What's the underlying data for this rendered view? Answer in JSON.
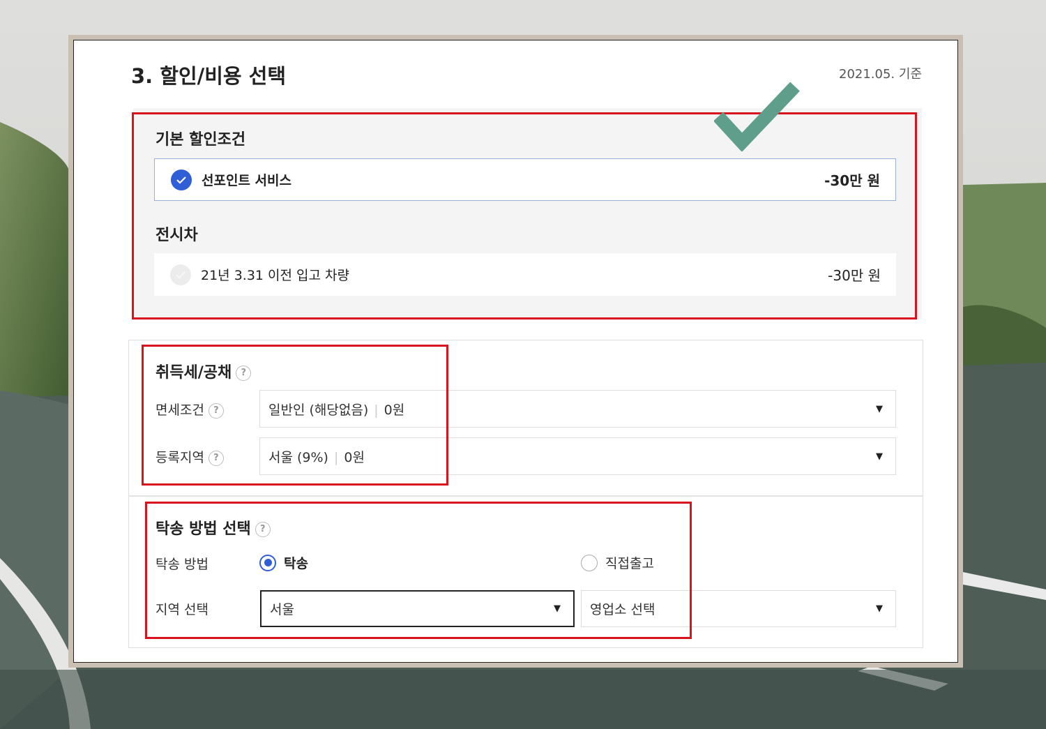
{
  "header": {
    "title": "3. 할인/비용 선택",
    "date": "2021.05. 기준"
  },
  "discount": {
    "basic_heading": "기본 할인조건",
    "basic_option": {
      "label": "선포인트 서비스",
      "price": "-30만 원",
      "checked": true
    },
    "display_heading": "전시차",
    "display_option": {
      "label": "21년 3.31 이전 입고 차량",
      "price": "-30만 원",
      "checked": false
    }
  },
  "tax": {
    "heading": "취득세/공채",
    "help": "?",
    "exemption": {
      "label": "면세조건",
      "value": "일반인 (해당없음)",
      "amount": "0원"
    },
    "region": {
      "label": "등록지역",
      "value": "서울 (9%)",
      "amount": "0원"
    }
  },
  "delivery": {
    "heading": "탁송 방법 선택",
    "help": "?",
    "method_label": "탁송 방법",
    "options": [
      {
        "label": "탁송",
        "selected": true
      },
      {
        "label": "직접출고",
        "selected": false
      }
    ],
    "region_label": "지역 선택",
    "region_value": "서울",
    "branch_placeholder": "영업소 선택"
  },
  "icons": {
    "dropdown": "▼",
    "check": "check-icon"
  },
  "colors": {
    "accent": "#2f5ed6",
    "highlight": "#d9131e",
    "checkmark": "#5f9e8a"
  }
}
